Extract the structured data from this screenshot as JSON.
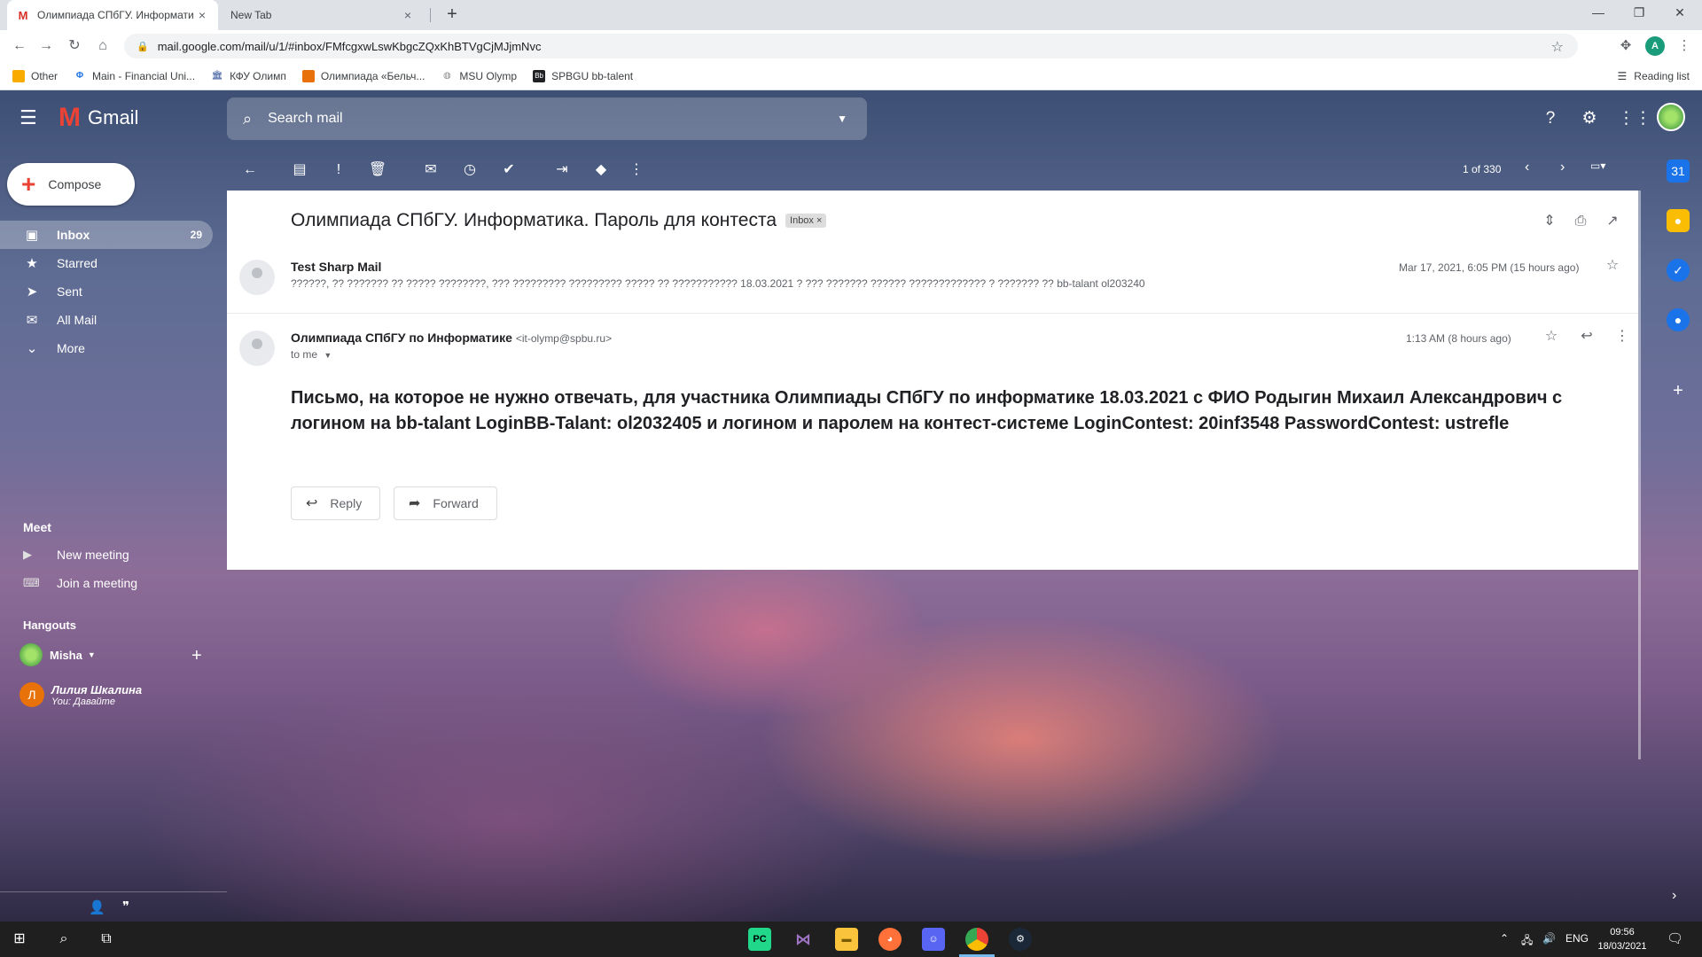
{
  "browser": {
    "tabs": [
      {
        "title": "Олимпиада СПбГУ. Информати",
        "active": true,
        "favicon": "gmail-icon"
      },
      {
        "title": "New Tab",
        "active": false
      }
    ],
    "new_tab": "+",
    "url": "mail.google.com/mail/u/1/#inbox/FMfcgxwLswKbgcZQxKhBTVgCjMJjmNvc",
    "bookmarks": [
      {
        "label": "Other",
        "icon": "folder-icon"
      },
      {
        "label": "Main - Financial Uni...",
        "icon": "phi-icon"
      },
      {
        "label": "КФУ Олимп",
        "icon": "building-icon"
      },
      {
        "label": "Олимпиада «Бельч...",
        "icon": "grid-icon"
      },
      {
        "label": "MSU Olymp",
        "icon": "globe-icon"
      },
      {
        "label": "SPBGU bb-talent",
        "icon": "bb-icon"
      }
    ],
    "reading_list": "Reading list"
  },
  "gmail": {
    "logo_text": "Gmail",
    "search_placeholder": "Search mail",
    "compose_label": "Compose",
    "nav": [
      {
        "label": "Inbox",
        "count": "29",
        "icon": "inbox-icon",
        "active": true
      },
      {
        "label": "Starred",
        "count": "",
        "icon": "star-icon",
        "active": false
      },
      {
        "label": "Sent",
        "count": "",
        "icon": "send-icon",
        "active": false
      },
      {
        "label": "All Mail",
        "count": "",
        "icon": "mail-icon",
        "active": false
      },
      {
        "label": "More",
        "count": "",
        "icon": "chevron-down-icon",
        "active": false
      }
    ],
    "meet": {
      "title": "Meet",
      "new_meeting": "New meeting",
      "join_meeting": "Join a meeting"
    },
    "hangouts": {
      "title": "Hangouts",
      "user": "Misha",
      "contact_initial": "Л",
      "contact_name": "Лилия Шкалина",
      "contact_status": "You: Давайте"
    },
    "pager": "1 of 330"
  },
  "email": {
    "subject": "Олимпиада СПбГУ. Информатика. Пароль для контеста",
    "label_badge": "Inbox ×",
    "messages": [
      {
        "from": "Test Sharp Mail",
        "snippet": "??????, ?? ??????? ?? ????? ????????, ??? ????????? ????????? ????? ?? ??????????? 18.03.2021 ? ??? ??????? ?????? ????????????? ? ??????? ?? bb-talant ol203240",
        "date": "Mar 17, 2021, 6:05 PM (15 hours ago)"
      },
      {
        "from": "Олимпиада СПбГУ по Информатике",
        "email": "<it-olymp@spbu.ru>",
        "to": "to me",
        "date": "1:13 AM (8 hours ago)",
        "body": "Письмо, на которое не нужно отвечать, для участника Олимпиады СПбГУ по информатике 18.03.2021 с ФИО Родыгин Михаил Александрович с логином на bb-talant LoginBB-Talant: ol2032405 и логином и паролем на контест-системе LoginContest: 20inf3548 PasswordContest: ustrefle"
      }
    ],
    "reply_label": "Reply",
    "forward_label": "Forward"
  },
  "taskbar": {
    "language": "ENG",
    "time": "09:56",
    "date": "18/03/2021"
  }
}
